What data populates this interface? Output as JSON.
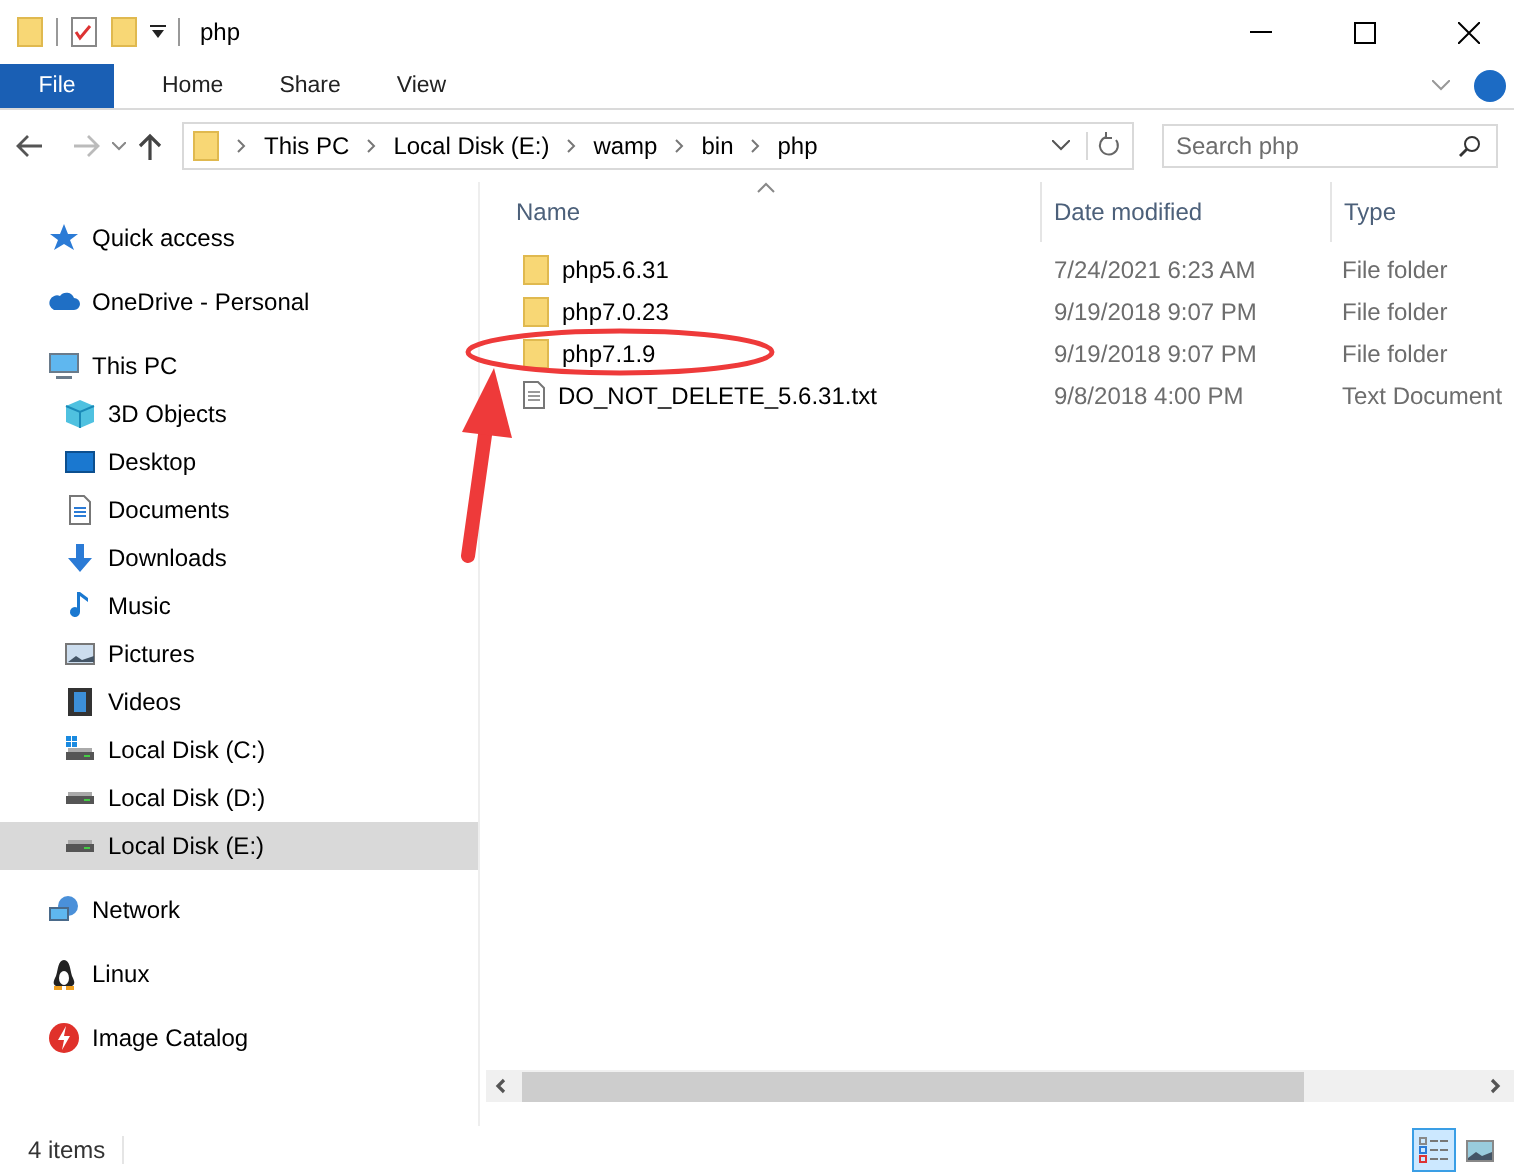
{
  "window": {
    "title": "php"
  },
  "ribbon_tabs": [
    {
      "label": "File",
      "selected": true
    },
    {
      "label": "Home",
      "selected": false
    },
    {
      "label": "Share",
      "selected": false
    },
    {
      "label": "View",
      "selected": false
    }
  ],
  "address": {
    "crumbs": [
      "This PC",
      "Local Disk (E:)",
      "wamp",
      "bin",
      "php"
    ]
  },
  "search": {
    "placeholder": "Search php"
  },
  "sidebar": {
    "items": [
      {
        "label": "Quick access",
        "selected": false
      },
      {
        "label": "OneDrive - Personal",
        "selected": false
      },
      {
        "label": "This PC",
        "selected": false,
        "children": [
          {
            "label": "3D Objects",
            "selected": false
          },
          {
            "label": "Desktop",
            "selected": false
          },
          {
            "label": "Documents",
            "selected": false
          },
          {
            "label": "Downloads",
            "selected": false
          },
          {
            "label": "Music",
            "selected": false
          },
          {
            "label": "Pictures",
            "selected": false
          },
          {
            "label": "Videos",
            "selected": false
          },
          {
            "label": "Local Disk (C:)",
            "selected": false
          },
          {
            "label": "Local Disk (D:)",
            "selected": false
          },
          {
            "label": "Local Disk (E:)",
            "selected": true
          }
        ]
      },
      {
        "label": "Network",
        "selected": false
      },
      {
        "label": "Linux",
        "selected": false
      },
      {
        "label": "Image Catalog",
        "selected": false
      }
    ]
  },
  "table": {
    "columns": [
      "Name",
      "Date modified",
      "Type"
    ],
    "rows": [
      {
        "kind": "folder",
        "name": "php5.6.31",
        "date": "7/24/2021 6:23 AM",
        "type": "File folder"
      },
      {
        "kind": "folder",
        "name": "php7.0.23",
        "date": "9/19/2018 9:07 PM",
        "type": "File folder"
      },
      {
        "kind": "folder",
        "name": "php7.1.9",
        "date": "9/19/2018 9:07 PM",
        "type": "File folder"
      },
      {
        "kind": "text",
        "name": "DO_NOT_DELETE_5.6.31.txt",
        "date": "9/8/2018 4:00 PM",
        "type": "Text Document"
      }
    ]
  },
  "status_bar": {
    "count": "4 items",
    "views": [
      {
        "selected": true
      },
      {
        "selected": false
      }
    ]
  }
}
